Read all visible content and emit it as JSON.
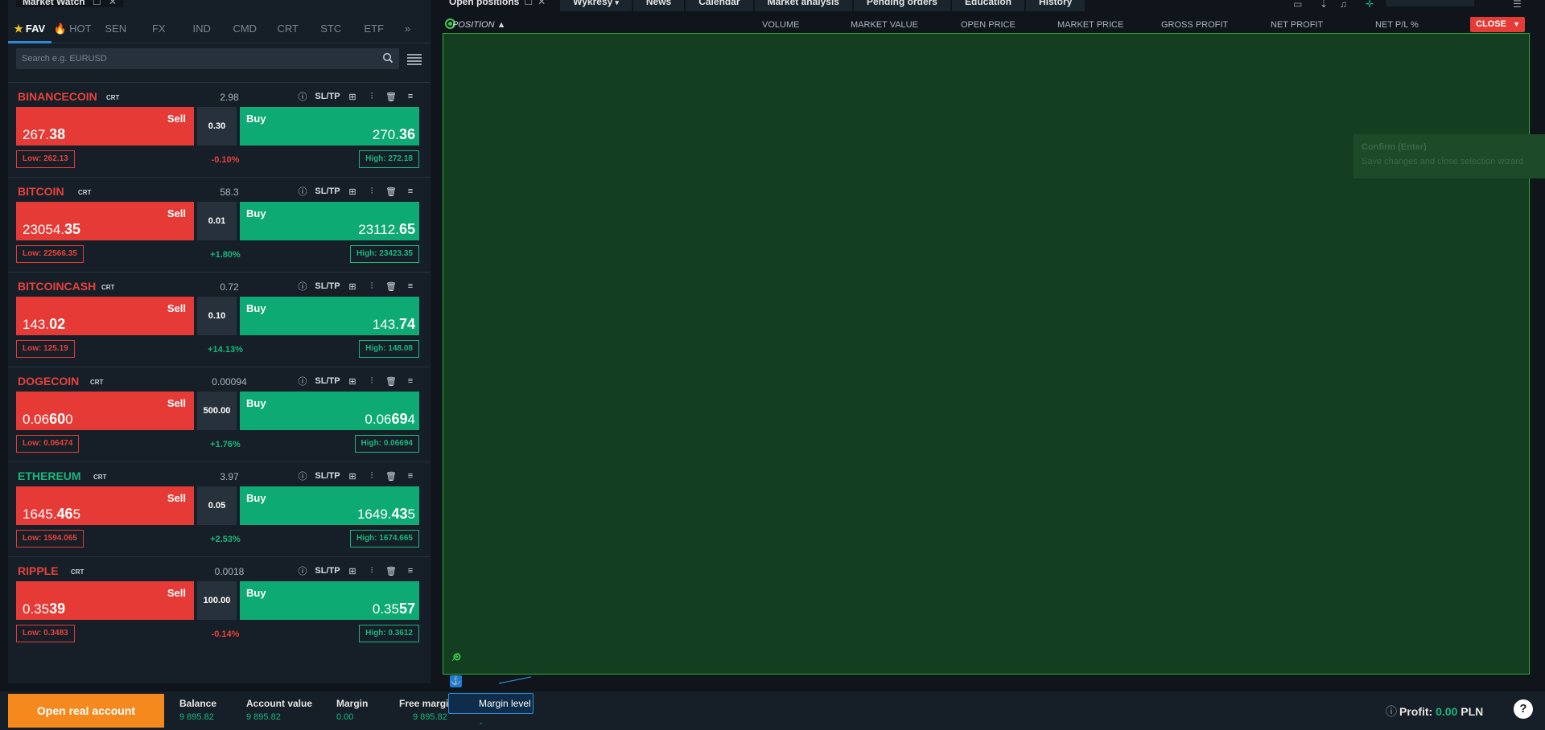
{
  "market_watch": {
    "title": "Market Watch",
    "search_placeholder": "Search e.g. EURUSD",
    "tabs": [
      {
        "label": "FAV"
      },
      {
        "label": "HOT"
      },
      {
        "label": "SEN"
      },
      {
        "label": "FX"
      },
      {
        "label": "IND"
      },
      {
        "label": "CMD"
      },
      {
        "label": "CRT"
      },
      {
        "label": "STC"
      },
      {
        "label": "ETF"
      }
    ],
    "sltp_label": "SL/TP",
    "sell_label": "Sell",
    "buy_label": "Buy",
    "instruments": [
      {
        "name": "BINANCECOIN",
        "tag": "CRT",
        "spread": "2.98",
        "sell_main": "267.",
        "sell_big": "38",
        "sell_tail": "",
        "buy_main": "270.",
        "buy_big": "36",
        "buy_tail": "",
        "volume": "0.30",
        "low": "Low: 262.13",
        "high": "High: 272.18",
        "change": "-0.10%",
        "change_dir": "neg",
        "name_color": "red"
      },
      {
        "name": "BITCOIN",
        "tag": "CRT",
        "spread": "58.3",
        "sell_main": "23054.",
        "sell_big": "35",
        "sell_tail": "",
        "buy_main": "23112.",
        "buy_big": "65",
        "buy_tail": "",
        "volume": "0.01",
        "low": "Low: 22566.35",
        "high": "High: 23423.35",
        "change": "+1.80%",
        "change_dir": "pos",
        "name_color": "red"
      },
      {
        "name": "BITCOINCASH",
        "tag": "CRT",
        "spread": "0.72",
        "sell_main": "143.",
        "sell_big": "02",
        "sell_tail": "",
        "buy_main": "143.",
        "buy_big": "74",
        "buy_tail": "",
        "volume": "0.10",
        "low": "Low: 125.19",
        "high": "High: 148.08",
        "change": "+14.13%",
        "change_dir": "pos",
        "name_color": "red"
      },
      {
        "name": "DOGECOIN",
        "tag": "CRT",
        "spread": "0.00094",
        "sell_main": "0.06",
        "sell_big": "60",
        "sell_tail": "0",
        "buy_main": "0.06",
        "buy_big": "69",
        "buy_tail": "4",
        "volume": "500.00",
        "low": "Low: 0.06474",
        "high": "High: 0.06694",
        "change": "+1.76%",
        "change_dir": "pos",
        "name_color": "red"
      },
      {
        "name": "ETHEREUM",
        "tag": "CRT",
        "spread": "3.97",
        "sell_main": "1645.",
        "sell_big": "46",
        "sell_tail": "5",
        "buy_main": "1649.",
        "buy_big": "43",
        "buy_tail": "5",
        "volume": "0.05",
        "low": "Low: 1594.065",
        "high": "High: 1674.665",
        "change": "+2.53%",
        "change_dir": "pos",
        "name_color": "green"
      },
      {
        "name": "RIPPLE",
        "tag": "CRT",
        "spread": "0.0018",
        "sell_main": "0.35",
        "sell_big": "39",
        "sell_tail": "",
        "buy_main": "0.35",
        "buy_big": "57",
        "buy_tail": "",
        "volume": "100.00",
        "low": "Low: 0.3483",
        "high": "High: 0.3612",
        "change": "-0.14%",
        "change_dir": "neg",
        "name_color": "red"
      }
    ]
  },
  "top_tabs": [
    "Open positions",
    "Wykresy",
    "News",
    "Calendar",
    "Market analysis",
    "Pending orders",
    "Education",
    "History"
  ],
  "positions_table": {
    "columns": [
      "POSITION ▲",
      "VOLUME",
      "MARKET VALUE",
      "OPEN PRICE",
      "MARKET PRICE",
      "GROSS PROFIT",
      "NET PROFIT",
      "NET P/L %"
    ],
    "close_label": "CLOSE"
  },
  "tooltip": {
    "title": "Confirm (Enter)",
    "text": "Save changes and close selection wizard"
  },
  "bottom_bar": {
    "open_real_label": "Open real account",
    "stats": [
      {
        "label": "Balance",
        "value": "9 895.82"
      },
      {
        "label": "Account value",
        "value": "9 895.82"
      },
      {
        "label": "Margin",
        "value": "0.00"
      },
      {
        "label": "Free margin",
        "value": "9 895.82"
      },
      {
        "label": "Margin level",
        "value": "-"
      }
    ],
    "profit_label": "Profit:",
    "profit_value": "0.00",
    "currency": "PLN",
    "help_label": "?"
  },
  "colors": {
    "sell": "#e53a35",
    "buy": "#0eaa73",
    "selection_overlay": "#143e20",
    "accent_orange": "#f5891e"
  }
}
